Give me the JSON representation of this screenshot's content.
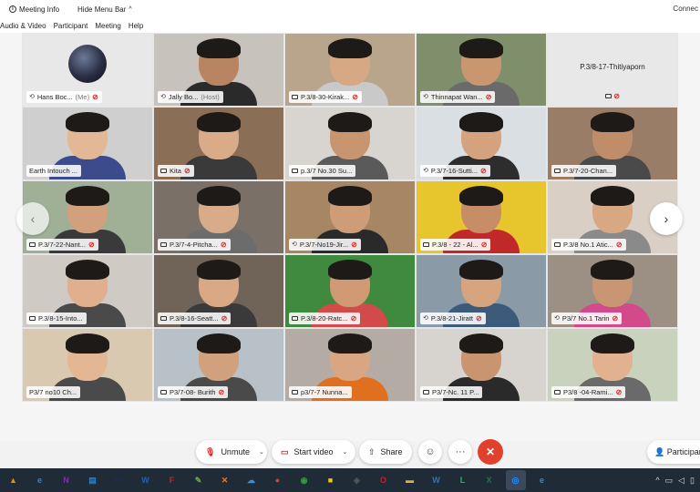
{
  "topbar": {
    "meeting_info": "Meeting Info",
    "hide_menu_bar": "Hide Menu Bar",
    "connect": "Connec"
  },
  "menubar": {
    "items": [
      "Audio & Video",
      "Participant",
      "Meeting",
      "Help"
    ]
  },
  "participants": [
    {
      "name": "Hans Boc...",
      "suffix": "(Me)",
      "icon": "share-icon",
      "muted": true,
      "kind": "avatar",
      "bg": "#e8e8e8"
    },
    {
      "name": "Jally Bo...",
      "suffix": "(Host)",
      "icon": "share-icon",
      "muted": false,
      "kind": "video",
      "bg": "#c8c2bc",
      "skin": "#b98461",
      "shirt": "#2a2a2a"
    },
    {
      "name": "P.3/8-30-Kirak...",
      "suffix": "",
      "icon": "screen-icon",
      "muted": true,
      "kind": "video",
      "bg": "#b9a48c",
      "skin": "#d7a884",
      "shirt": "#c9c9c9"
    },
    {
      "name": "Thinnapat Wan...",
      "suffix": "",
      "icon": "share-icon",
      "muted": true,
      "kind": "video",
      "bg": "#7f8f6c",
      "skin": "#c99670",
      "shirt": "#6a6a6a"
    },
    {
      "name": "P.3/8-17-Thitiyaporn",
      "suffix": "",
      "icon": "screen-icon",
      "muted": true,
      "kind": "blank",
      "bg": "#e8e8e8"
    },
    {
      "name": "Earth Intouch ...",
      "suffix": "",
      "icon": "",
      "muted": false,
      "kind": "video",
      "bg": "#cfcfcf",
      "skin": "#e2b896",
      "shirt": "#3c4b8c"
    },
    {
      "name": "Kita",
      "suffix": "",
      "icon": "screen-icon",
      "muted": true,
      "kind": "video",
      "bg": "#8a6e55",
      "skin": "#d9ab88",
      "shirt": "#3a3a3a"
    },
    {
      "name": "p.3/7 No.30 Su...",
      "suffix": "",
      "icon": "screen-icon",
      "muted": false,
      "kind": "video",
      "bg": "#d8d4cf",
      "skin": "#c89571",
      "shirt": "#5a5a5a"
    },
    {
      "name": "P.3/7-16-Sutti...",
      "suffix": "",
      "icon": "share-icon",
      "muted": true,
      "kind": "video",
      "bg": "#dadfe4",
      "skin": "#d4a27e",
      "shirt": "#2d2d2d"
    },
    {
      "name": "P.3/7-20-Chan...",
      "suffix": "",
      "icon": "screen-icon",
      "muted": false,
      "kind": "video",
      "bg": "#9a7d66",
      "skin": "#c08d6a",
      "shirt": "#4a4a4a"
    },
    {
      "name": "P.3/7-22-Nant...",
      "suffix": "",
      "icon": "screen-icon",
      "muted": true,
      "kind": "video",
      "bg": "#9fb097",
      "skin": "#d2a07c",
      "shirt": "#3a3a3a"
    },
    {
      "name": "P.3/7-4-Pitcha...",
      "suffix": "",
      "icon": "screen-icon",
      "muted": true,
      "kind": "video",
      "bg": "#7a7068",
      "skin": "#d8ab8a",
      "shirt": "#6c6c6c"
    },
    {
      "name": "P.3/7-No19-Jir...",
      "suffix": "",
      "icon": "share-icon",
      "muted": true,
      "kind": "video",
      "bg": "#a78663",
      "skin": "#cf9c78",
      "shirt": "#2a2a2a"
    },
    {
      "name": "P.3/8 - 22 - Al...",
      "suffix": "",
      "icon": "screen-icon",
      "muted": true,
      "kind": "video",
      "bg": "#e7c52d",
      "skin": "#c78d66",
      "shirt": "#c0282a"
    },
    {
      "name": "P.3/8 No.1 Atic...",
      "suffix": "",
      "icon": "screen-icon",
      "muted": true,
      "kind": "video",
      "bg": "#d9cfc5",
      "skin": "#d8a882",
      "shirt": "#8a8a8a"
    },
    {
      "name": "P.3/8-15-Into...",
      "suffix": "",
      "icon": "screen-icon",
      "muted": false,
      "kind": "video",
      "bg": "#cfcac4",
      "skin": "#e0b08e",
      "shirt": "#4a4a4a"
    },
    {
      "name": "P.3/8-16-Seatt...",
      "suffix": "",
      "icon": "screen-icon",
      "muted": true,
      "kind": "video",
      "bg": "#706458",
      "skin": "#d9a985",
      "shirt": "#3a3a3a"
    },
    {
      "name": "P.3/8-20-Ratc...",
      "suffix": "",
      "icon": "screen-icon",
      "muted": true,
      "kind": "video",
      "bg": "#3f8a3f",
      "skin": "#cf9a74",
      "shirt": "#d24a4a"
    },
    {
      "name": "P.3/8-21-Jiratt",
      "suffix": "",
      "icon": "share-icon",
      "muted": true,
      "kind": "video",
      "bg": "#8a9aa6",
      "skin": "#d7a480",
      "shirt": "#3c5a7a"
    },
    {
      "name": "P3/7 No.1 Tarin",
      "suffix": "",
      "icon": "share-icon",
      "muted": true,
      "kind": "video",
      "bg": "#9c8f83",
      "skin": "#c99673",
      "shirt": "#d24a8a"
    },
    {
      "name": "P3/7 no10 Ch...",
      "suffix": "",
      "icon": "",
      "muted": false,
      "kind": "video",
      "bg": "#d9c9b1",
      "skin": "#e4b794",
      "shirt": "#4a4a4a"
    },
    {
      "name": "P3/7-08- Burith",
      "suffix": "",
      "icon": "screen-icon",
      "muted": true,
      "kind": "video",
      "bg": "#b8c0c8",
      "skin": "#d1a07c",
      "shirt": "#4a4a4a"
    },
    {
      "name": "p3/7-7 Nunna...",
      "suffix": "",
      "icon": "screen-icon",
      "muted": false,
      "kind": "video",
      "bg": "#b4aca4",
      "skin": "#d8a683",
      "shirt": "#e07020"
    },
    {
      "name": "P3/7-Nc. 11 P...",
      "suffix": "",
      "icon": "screen-icon",
      "muted": false,
      "kind": "video",
      "bg": "#d7d3cf",
      "skin": "#c99571",
      "shirt": "#2a2a2a"
    },
    {
      "name": "P3/8 -04-Rami...",
      "suffix": "",
      "icon": "screen-icon",
      "muted": true,
      "kind": "video",
      "bg": "#c8d2bc",
      "skin": "#e2b290",
      "shirt": "#6a6a6a"
    }
  ],
  "controls": {
    "unmute": "Unmute",
    "start_video": "Start video",
    "share": "Share",
    "participants": "Participan"
  },
  "colors": {
    "accent_red": "#e02828",
    "end_button": "#e0402c",
    "taskbar": "#1f2c38"
  },
  "taskbar": {
    "apps": [
      {
        "name": "vlc-icon",
        "glyph": "▲",
        "color": "#f08a00"
      },
      {
        "name": "edge-icon",
        "glyph": "e",
        "color": "#1f8fd6"
      },
      {
        "name": "onenote-icon",
        "glyph": "N",
        "color": "#7b2fa8"
      },
      {
        "name": "control-panel-icon",
        "glyph": "▤",
        "color": "#2f7fc1"
      },
      {
        "name": "photoshop-icon",
        "glyph": "Ps",
        "color": "#1a2f4f"
      },
      {
        "name": "word-icon",
        "glyph": "W",
        "color": "#2b5fb4"
      },
      {
        "name": "filezilla-icon",
        "glyph": "F",
        "color": "#c0262e"
      },
      {
        "name": "notepadpp-icon",
        "glyph": "✎",
        "color": "#6aa84f"
      },
      {
        "name": "xampp-icon",
        "glyph": "✕",
        "color": "#f07a2a"
      },
      {
        "name": "onedrive-icon",
        "glyph": "☁",
        "color": "#3a8ae0"
      },
      {
        "name": "powerpoint-icon",
        "glyph": "●",
        "color": "#d24726"
      },
      {
        "name": "chrome-icon",
        "glyph": "◉",
        "color": "#3a9a4a"
      },
      {
        "name": "sticky-notes-icon",
        "glyph": "■",
        "color": "#f2c811"
      },
      {
        "name": "unity-icon",
        "glyph": "◈",
        "color": "#555"
      },
      {
        "name": "opera-icon",
        "glyph": "O",
        "color": "#d01c2a"
      },
      {
        "name": "file-explorer-icon",
        "glyph": "▬",
        "color": "#e8b02a"
      },
      {
        "name": "wps-icon",
        "glyph": "W",
        "color": "#2f6fd8"
      },
      {
        "name": "line-icon",
        "glyph": "L",
        "color": "#2fb84a"
      },
      {
        "name": "excel-icon",
        "glyph": "X",
        "color": "#1f7a43"
      },
      {
        "name": "zoom-app-icon",
        "glyph": "◎",
        "color": "#2d8cff"
      },
      {
        "name": "internet-explorer-icon",
        "glyph": "e",
        "color": "#2a8fd8"
      }
    ]
  }
}
